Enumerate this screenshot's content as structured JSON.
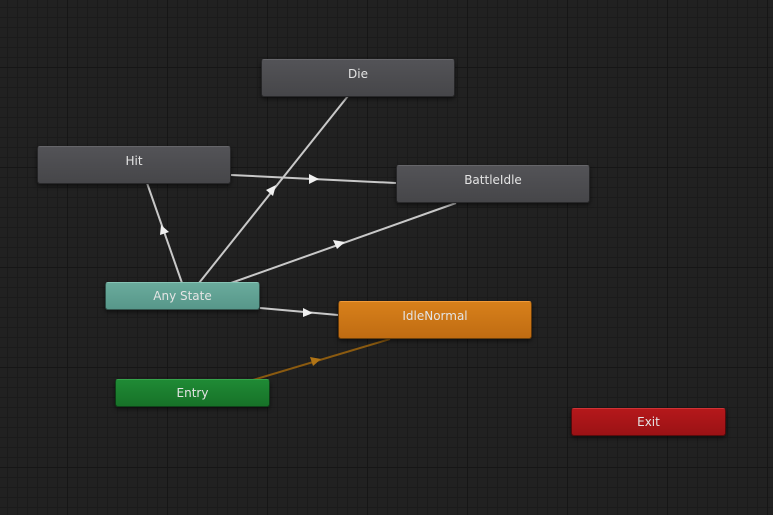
{
  "states": {
    "die": "Die",
    "hit": "Hit",
    "battle_idle": "BattleIdle",
    "any_state": "Any State",
    "idle_normal": "IdleNormal",
    "entry": "Entry",
    "exit": "Exit"
  },
  "transitions": [
    {
      "from": "Any State",
      "to": "Hit"
    },
    {
      "from": "Any State",
      "to": "Die"
    },
    {
      "from": "Any State",
      "to": "BattleIdle"
    },
    {
      "from": "Any State",
      "to": "IdleNormal"
    },
    {
      "from": "Hit",
      "to": "BattleIdle"
    },
    {
      "from": "Entry",
      "to": "IdleNormal"
    }
  ],
  "colors": {
    "grid_background": "#212121",
    "state_node": "#4d4d50",
    "any_state_node": "#5f9f91",
    "entry_node": "#1b7e2f",
    "exit_node": "#a81518",
    "default_state_node": "#cc7515",
    "transition_line": "#c8c8c8",
    "default_transition_line": "#8a5a10"
  }
}
